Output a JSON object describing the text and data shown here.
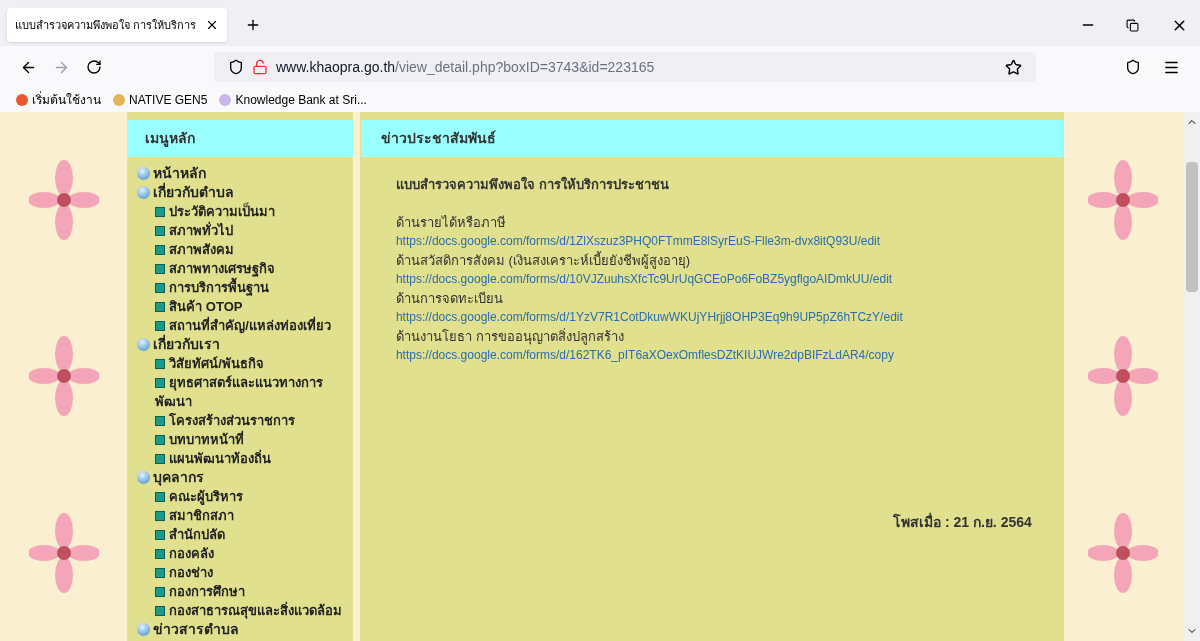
{
  "browser": {
    "tab": {
      "title": "แบบสำรวจความพึงพอใจ การให้บริการ",
      "selected": true
    },
    "url": {
      "host": "www.khaopra.go.th",
      "path": "/view_detail.php?boxID=3743&id=223165"
    },
    "bookmarks": [
      "เริ่มต้นใช้งาน",
      "NATIVE GEN5",
      "Knowledge Bank at Sri..."
    ]
  },
  "menu": {
    "title": "เมนูหลัก",
    "items": [
      {
        "label": "หน้าหลัก"
      },
      {
        "label": "เกี่ยวกับตำบล",
        "children": [
          {
            "label": "ประวัติความเป็นมา"
          },
          {
            "label": "สภาพทั่วไป"
          },
          {
            "label": "สภาพสังคม"
          },
          {
            "label": "สภาพทางเศรษฐกิจ"
          },
          {
            "label": "การบริการพื้นฐาน"
          },
          {
            "label": "สินค้า OTOP"
          },
          {
            "label": "สถานที่สำคัญ/แหล่งท่องเที่ยว"
          }
        ]
      },
      {
        "label": "เกี่ยวกับเรา",
        "children": [
          {
            "label": "วิสัยทัศน์/พันธกิจ"
          },
          {
            "label": "ยุทธศาสตร์และแนวทางการพัฒนา"
          },
          {
            "label": "โครงสร้างส่วนราชการ"
          },
          {
            "label": "บทบาทหน้าที่"
          },
          {
            "label": "แผนพัฒนาท้องถิ่น"
          }
        ]
      },
      {
        "label": "บุคลากร",
        "children": [
          {
            "label": "คณะผู้บริหาร"
          },
          {
            "label": "สมาชิกสภา"
          },
          {
            "label": "สำนักปลัด"
          },
          {
            "label": "กองคลัง"
          },
          {
            "label": "กองช่าง"
          },
          {
            "label": "กองการศึกษา"
          },
          {
            "label": "กองสาธารณสุขและสิ่งแวดล้อม"
          }
        ]
      },
      {
        "label": "ข่าวสารตำบล"
      }
    ]
  },
  "article": {
    "section": "ข่าวประชาสัมพันธ์",
    "title": "แบบสำรวจความพึงพอใจ การให้บริการประชาชน",
    "entries": [
      {
        "label": "ด้านรายได้หรือภาษี",
        "link": "https://docs.google.com/forms/d/1ZlXszuz3PHQ0FTmmE8lSyrEuS-Flle3m-dvx8itQ93U/edit"
      },
      {
        "label": "ด้านสวัสดิการสังคม (เงินสงเคราะห์เบี้ยยังชีพผู้สูงอายุ)",
        "link": "https://docs.google.com/forms/d/10VJZuuhsXfcTc9UrUqGCEoPo6FoBZ5ygflgoAIDmkUU/edit"
      },
      {
        "label": "ด้านการจดทะเบียน",
        "link": "https://docs.google.com/forms/d/1YzV7R1CotDkuwWKUjYHrjj8OHP3Eq9h9UP5pZ6hTCzY/edit"
      },
      {
        "label": "ด้านงานโยธา การขออนุญาตสิ่งปลูกสร้าง",
        "link": "https://docs.google.com/forms/d/162TK6_pIT6aXOexOmflesDZtKIUJWre2dpBIFzLdAR4/copy"
      }
    ],
    "posted": "โพสเมื่อ : 21 ก.ย. 2564"
  }
}
